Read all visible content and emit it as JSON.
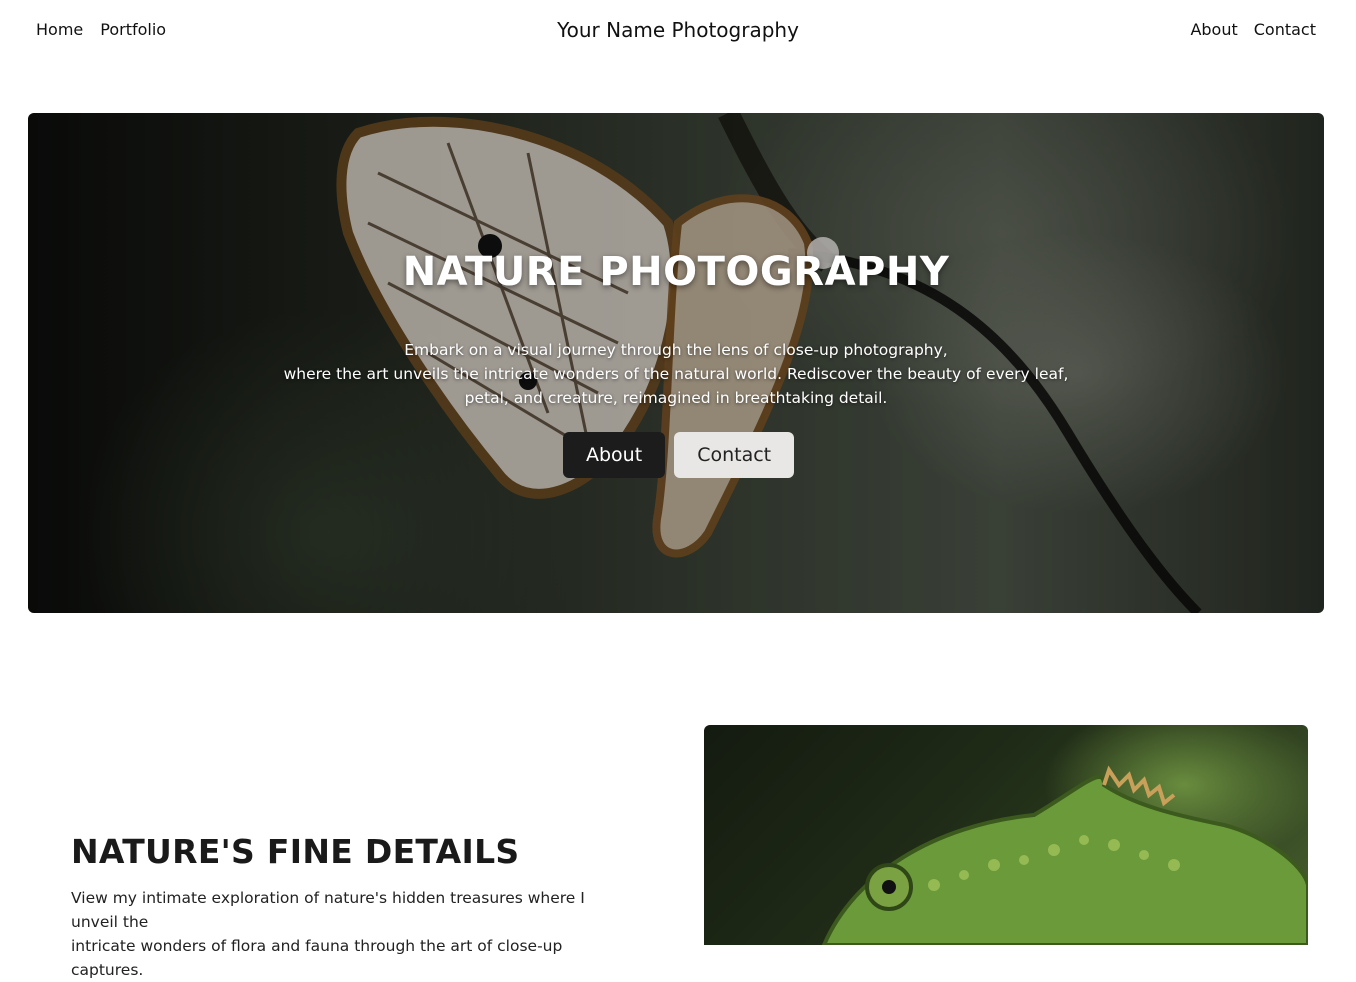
{
  "nav": {
    "left": [
      "Home",
      "Portfolio"
    ],
    "brand": "Your Name Photography",
    "right": [
      "About",
      "Contact"
    ]
  },
  "hero": {
    "title": "NATURE PHOTOGRAPHY",
    "text_lines": [
      "Embark on a visual journey through the lens of close-up photography,",
      "where the art unveils the intricate wonders of the natural world. Rediscover the beauty of every leaf,",
      "petal, and creature, reimagined in breathtaking detail."
    ],
    "buttons": {
      "primary": "About",
      "secondary": "Contact"
    },
    "image": "butterfly-photo"
  },
  "section": {
    "title": "NATURE'S FINE DETAILS",
    "text_lines": [
      "View my intimate exploration of nature's hidden treasures where I unveil the",
      "intricate wonders of flora and fauna through the art of close-up captures."
    ],
    "image": "chameleon-photo"
  },
  "colors": {
    "button_dark": "#1c1c1c",
    "button_light": "#e8e7e5"
  }
}
